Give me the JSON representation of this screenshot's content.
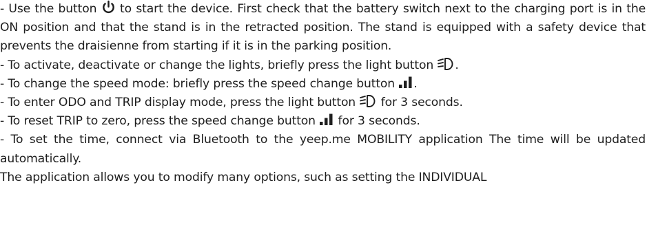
{
  "document": {
    "para1": {
      "before_icon": "- Use the button ",
      "icon": "power-icon",
      "after_icon": " to start the device. First check that the battery switch next to the charging port is in the ON position and that the stand is in the retracted position. The stand is equipped with a safety device that prevents the draisienne from starting if it is in the parking position."
    },
    "para2": {
      "before_icon": "- To activate, deactivate or change the lights, briefly press the light button ",
      "icon": "headlight-icon",
      "after_icon": "."
    },
    "para3": {
      "before_icon": "- To change the speed mode: briefly press the speed change button ",
      "icon": "speed-bars-icon",
      "after_icon": "."
    },
    "para4": {
      "before_icon": "- To enter ODO and TRIP display mode, press the light button ",
      "icon": "headlight-icon",
      "after_icon": " for 3 seconds."
    },
    "para5": {
      "before_icon": "- To reset TRIP to zero, press the speed change button ",
      "icon": "speed-bars-icon",
      "after_icon": " for 3 seconds."
    },
    "para6": {
      "text": "- To set the time, connect via Bluetooth to the yeep.me MOBILITY application The time will be updated automatically."
    },
    "para7": {
      "text": "The application allows you to modify many options, such as setting the INDIVIDUAL"
    }
  },
  "colors": {
    "text": "#1e1e1e"
  }
}
